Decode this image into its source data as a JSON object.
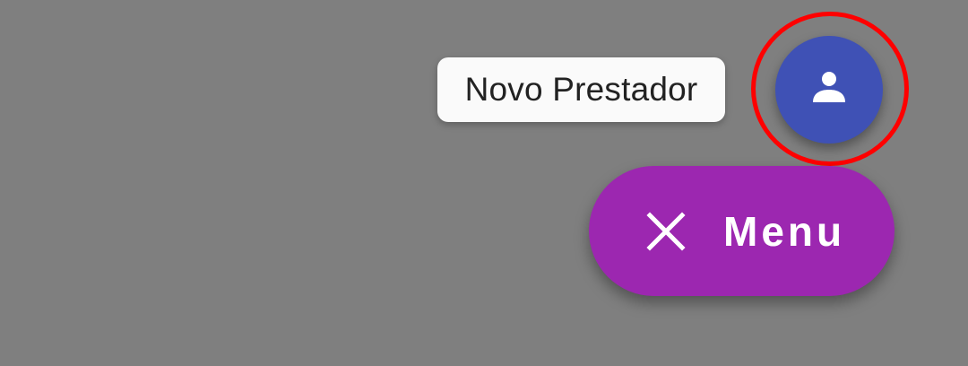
{
  "colors": {
    "backdrop": "#7f7f7f",
    "label_chip_background": "#fafafa",
    "label_chip_text": "#222222",
    "mini_fab_background": "#3f51b5",
    "menu_fab_background": "#9c27b0",
    "highlight_ring": "#ff0000",
    "icon_color": "#ffffff"
  },
  "speed_dial": {
    "actions": [
      {
        "label": "Novo Prestador",
        "icon": "person-icon"
      }
    ],
    "main_button": {
      "label": "Menu",
      "icon": "close-icon"
    }
  }
}
